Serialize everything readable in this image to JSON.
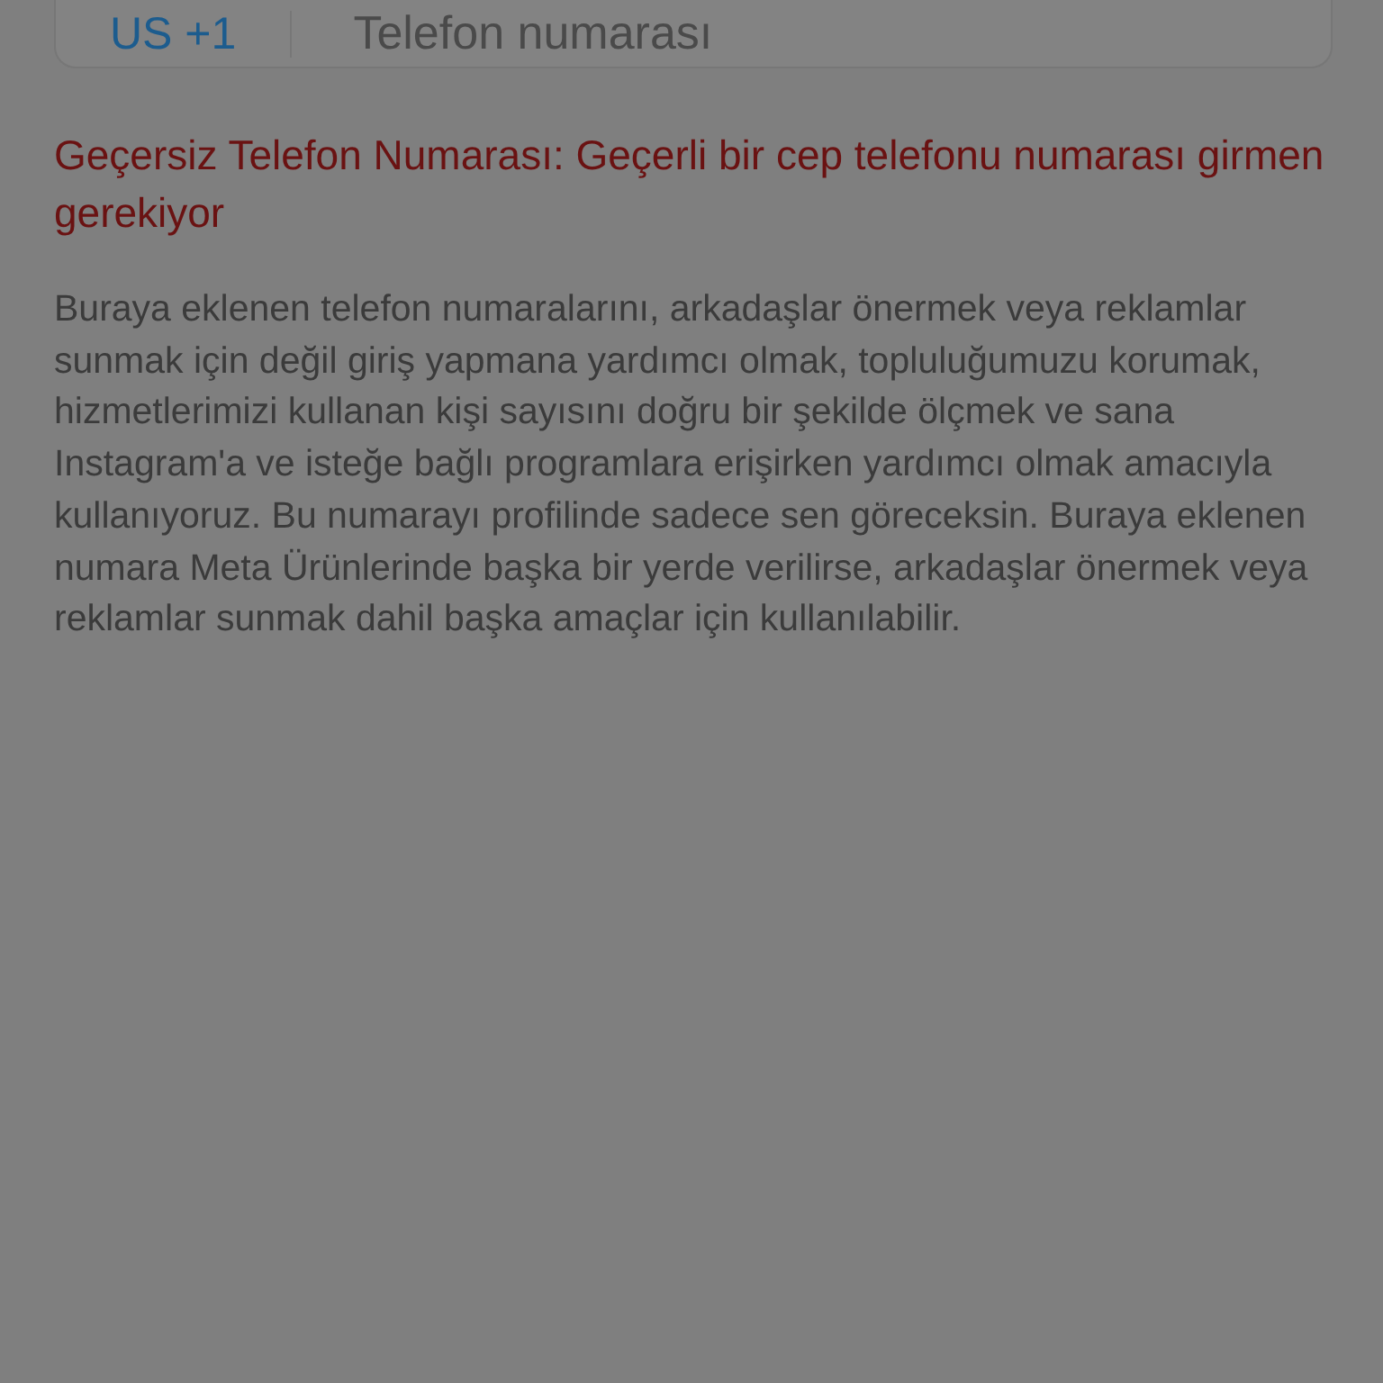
{
  "phone_field": {
    "country_code": "US +1",
    "placeholder": "Telefon numarası"
  },
  "error": "Geçersiz Telefon Numarası: Geçerli bir cep telefonu numarası girmen gerekiyor",
  "info": "Buraya eklenen telefon numaralarını, arkadaşlar önermek veya reklamlar sunmak için değil giriş yapmana yardımcı olmak, topluluğumuzu korumak, hizmetlerimizi kullanan kişi sayısını doğru bir şekilde ölçmek ve sana Instagram'a ve isteğe bağlı programlara erişirken yardımcı olmak amacıyla kullanıyoruz. Bu numarayı profilinde sadece sen göreceksin. Buraya eklenen numara Meta Ürünlerinde başka bir yerde verilirse, arkadaşlar önermek veya reklamlar sunmak dahil başka amaçlar için kullanılabilir."
}
